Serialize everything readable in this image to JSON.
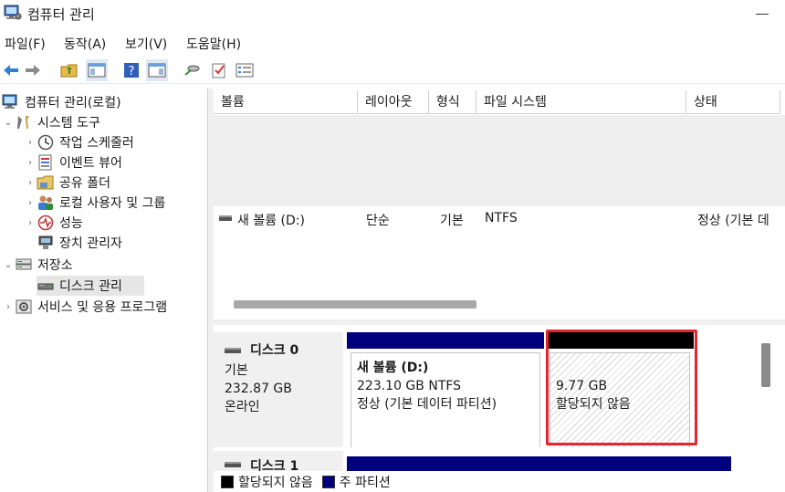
{
  "window": {
    "title": "컴퓨터 관리"
  },
  "menu": [
    "파일(F)",
    "동작(A)",
    "보기(V)",
    "도움말(H)"
  ],
  "tree": {
    "root": "컴퓨터 관리(로컬)",
    "system_tools": "시스템 도구",
    "task_scheduler": "작업 스케줄러",
    "event_viewer": "이벤트 뷰어",
    "shared_folders": "공유 폴더",
    "local_users": "로컬 사용자 및 그룹",
    "performance": "성능",
    "device_manager": "장치 관리자",
    "storage": "저장소",
    "disk_management": "디스크 관리",
    "services_apps": "서비스 및 응용 프로그램"
  },
  "columns": [
    "볼륨",
    "레이아웃",
    "형식",
    "파일 시스템",
    "상태"
  ],
  "volumes": [
    {
      "name": "새 볼륨 (D:)",
      "layout": "단순",
      "type": "기본",
      "fs": "NTFS",
      "status": "정상 (기본 데"
    }
  ],
  "disk0": {
    "name": "디스크 0",
    "type": "기본",
    "size": "232.87 GB",
    "state": "온라인",
    "partitions": [
      {
        "name": "새 볼륨  (D:)",
        "size": "223.10 GB NTFS",
        "status": "정상 (기본 데이터 파티션)",
        "bar_color": "#00007f"
      },
      {
        "size": "9.77 GB",
        "status": "할당되지 않음",
        "bar_color": "#000000"
      }
    ]
  },
  "disk1": {
    "name": "디스크 1"
  },
  "legend": [
    {
      "label": "할당되지 않음",
      "color": "#000000"
    },
    {
      "label": "주 파티션",
      "color": "#00007f"
    }
  ]
}
